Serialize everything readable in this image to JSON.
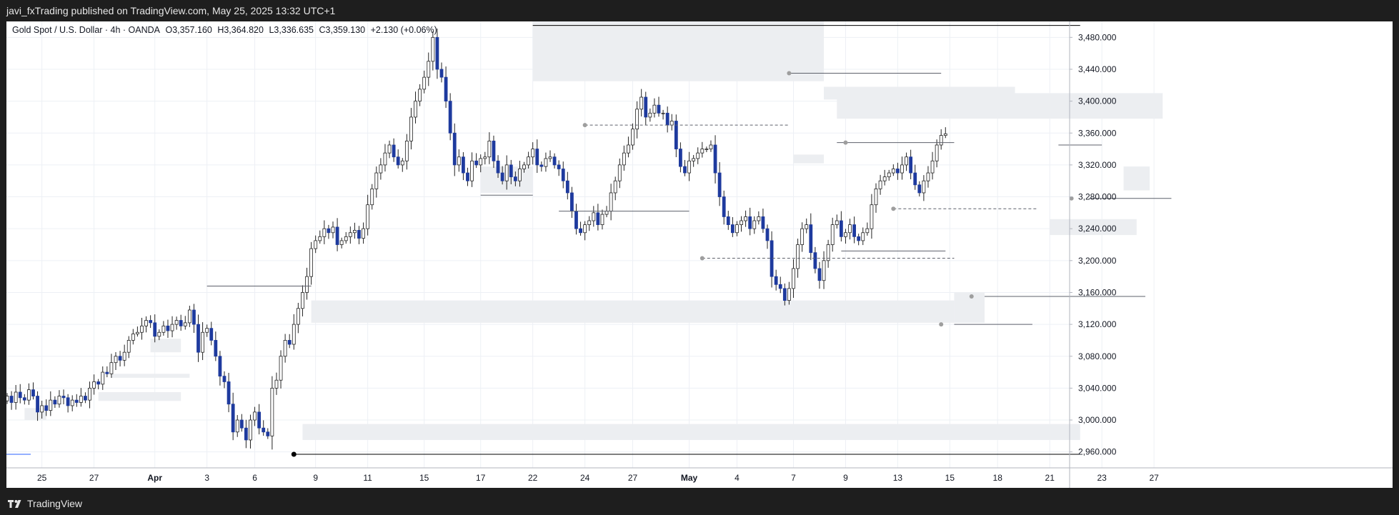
{
  "header": {
    "publisher_line": "javi_fxTrading published on TradingView.com, May 25, 2025 13:32 UTC+1"
  },
  "legend": {
    "symbol": "Gold Spot / U.S. Dollar · 4h · OANDA",
    "open": "O3,357.160",
    "high": "H3,364.820",
    "low": "L3,336.635",
    "close": "C3,359.130",
    "change": "+2.130 (+0.06%)"
  },
  "footer": {
    "brand": "TradingView",
    "logo_icon": "tradingview-logo-icon"
  },
  "colors": {
    "up_candle": "#ffffff",
    "down_candle": "#1e3a9e",
    "wick": "#222222",
    "zone": "#eceef1",
    "grid": "#edf0f5"
  },
  "chart_data": {
    "type": "candlestick",
    "symbol": "Gold Spot / U.S. Dollar",
    "interval": "4h",
    "ylim": [
      2940,
      3500
    ],
    "y_ticks": [
      "3,480.000",
      "3,440.000",
      "3,400.000",
      "3,360.000",
      "3,320.000",
      "3,280.000",
      "3,240.000",
      "3,200.000",
      "3,160.000",
      "3,120.000",
      "3,080.000",
      "3,040.000",
      "3,000.000",
      "2,960.000"
    ],
    "y_tick_values": [
      3480,
      3440,
      3400,
      3360,
      3320,
      3280,
      3240,
      3200,
      3160,
      3120,
      3080,
      3040,
      3000,
      2960
    ],
    "x_tick_labels": [
      "25",
      "27",
      "Apr",
      "3",
      "6",
      "9",
      "11",
      "15",
      "17",
      "22",
      "24",
      "27",
      "May",
      "4",
      "7",
      "9",
      "13",
      "15",
      "18",
      "21",
      "23",
      "27"
    ],
    "x_tick_bars": [
      8,
      20,
      34,
      46,
      57,
      71,
      83,
      96,
      109,
      121,
      133,
      144,
      157,
      168,
      181,
      193,
      205,
      217,
      228,
      240,
      252,
      264
    ],
    "bold_x_ticks": [
      "Apr",
      "May"
    ],
    "grid": true,
    "closes": [
      3030,
      3022,
      3035,
      3028,
      3025,
      3038,
      3030,
      3010,
      3018,
      3012,
      3025,
      3020,
      3030,
      3028,
      3018,
      3025,
      3022,
      3030,
      3025,
      3040,
      3048,
      3045,
      3060,
      3058,
      3072,
      3080,
      3075,
      3085,
      3100,
      3108,
      3110,
      3118,
      3125,
      3122,
      3105,
      3110,
      3118,
      3112,
      3120,
      3125,
      3118,
      3122,
      3138,
      3120,
      3085,
      3110,
      3115,
      3100,
      3080,
      3055,
      3048,
      3020,
      2985,
      3000,
      2990,
      2975,
      3000,
      3010,
      2990,
      2985,
      2980,
      3040,
      3050,
      3080,
      3100,
      3095,
      3120,
      3140,
      3160,
      3180,
      3215,
      3225,
      3230,
      3240,
      3235,
      3242,
      3220,
      3225,
      3230,
      3235,
      3238,
      3228,
      3240,
      3270,
      3290,
      3310,
      3320,
      3335,
      3345,
      3330,
      3320,
      3325,
      3350,
      3380,
      3400,
      3415,
      3430,
      3450,
      3480,
      3440,
      3430,
      3400,
      3360,
      3320,
      3330,
      3310,
      3300,
      3325,
      3320,
      3328,
      3330,
      3350,
      3325,
      3310,
      3300,
      3320,
      3305,
      3300,
      3315,
      3320,
      3330,
      3340,
      3320,
      3318,
      3328,
      3330,
      3320,
      3315,
      3300,
      3285,
      3262,
      3240,
      3235,
      3245,
      3250,
      3260,
      3245,
      3258,
      3262,
      3285,
      3300,
      3320,
      3335,
      3345,
      3365,
      3390,
      3405,
      3380,
      3385,
      3395,
      3385,
      3385,
      3370,
      3375,
      3340,
      3318,
      3310,
      3325,
      3328,
      3335,
      3340,
      3340,
      3345,
      3310,
      3280,
      3255,
      3245,
      3235,
      3245,
      3250,
      3255,
      3240,
      3250,
      3255,
      3240,
      3225,
      3180,
      3170,
      3165,
      3150,
      3165,
      3190,
      3220,
      3240,
      3245,
      3210,
      3190,
      3175,
      3200,
      3220,
      3245,
      3250,
      3230,
      3235,
      3245,
      3230,
      3225,
      3235,
      3240,
      3270,
      3290,
      3300,
      3305,
      3310,
      3315,
      3310,
      3320,
      3330,
      3310,
      3295,
      3285,
      3300,
      3310,
      3325,
      3345,
      3357,
      3359
    ],
    "last_close": 3359.13,
    "annotations": {
      "zones": [
        [
          4,
          9,
          3000,
          3015
        ],
        [
          21,
          40,
          3024,
          3035
        ],
        [
          24,
          42,
          3053,
          3058
        ],
        [
          33,
          40,
          3085,
          3102
        ],
        [
          68,
          247,
          2975,
          2995
        ],
        [
          70,
          218,
          3122,
          3150
        ],
        [
          109,
          121,
          3285,
          3318
        ],
        [
          121,
          188,
          3425,
          3500
        ],
        [
          188,
          232,
          3402,
          3418
        ],
        [
          191,
          266,
          3378,
          3410
        ],
        [
          181,
          188,
          3322,
          3333
        ],
        [
          218,
          225,
          3122,
          3160
        ],
        [
          240,
          260,
          3232,
          3252
        ],
        [
          257,
          263,
          3288,
          3318
        ]
      ],
      "lines": [
        [
          46,
          70,
          3168,
          "solid"
        ],
        [
          66,
          247,
          2957,
          "solid"
        ],
        [
          121,
          247,
          3495,
          "solid"
        ],
        [
          109,
          121,
          3282,
          "solid"
        ],
        [
          127,
          157,
          3262,
          "solid"
        ],
        [
          133,
          180,
          3370,
          "dashed"
        ],
        [
          160,
          218,
          3203,
          "dashed"
        ],
        [
          180,
          215,
          3435,
          "solid"
        ],
        [
          191,
          218,
          3348,
          "solid"
        ],
        [
          192,
          216,
          3212,
          "solid"
        ],
        [
          204,
          237,
          3265,
          "dashed"
        ],
        [
          218,
          236,
          3120,
          "solid"
        ],
        [
          225,
          262,
          3155,
          "solid"
        ],
        [
          242,
          252,
          3345,
          "solid"
        ],
        [
          249,
          268,
          3278,
          "solid"
        ]
      ],
      "points": [
        [
          66,
          2957,
          "#000000"
        ],
        [
          133,
          3370,
          "#9e9e9e"
        ],
        [
          160,
          3203,
          "#9e9e9e"
        ],
        [
          180,
          3435,
          "#9e9e9e"
        ],
        [
          193,
          3348,
          "#9e9e9e"
        ],
        [
          204,
          3265,
          "#9e9e9e"
        ],
        [
          215,
          3120,
          "#9e9e9e"
        ],
        [
          222,
          3155,
          "#9e9e9e"
        ],
        [
          245,
          3278,
          "#9e9e9e"
        ]
      ]
    }
  }
}
